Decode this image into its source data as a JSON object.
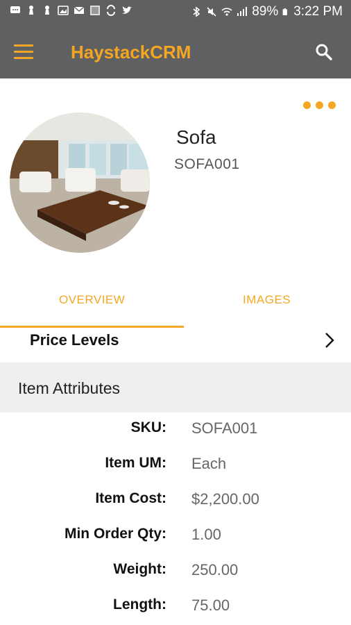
{
  "status_bar": {
    "battery": "89%",
    "time": "3:22 PM"
  },
  "app_bar": {
    "title": "HaystackCRM",
    "menu_icon": "hamburger-menu-icon",
    "search_icon": "search-icon",
    "accent_color": "#f5a623",
    "background_color": "#5f6061"
  },
  "item": {
    "name": "Sofa",
    "code": "SOFA001",
    "more_icon": "more-dots-icon"
  },
  "tabs": [
    {
      "label": "OVERVIEW",
      "active": true
    },
    {
      "label": "IMAGES",
      "active": false
    }
  ],
  "price_levels": {
    "label": "Price Levels",
    "icon": "chevron-right-icon"
  },
  "attributes": {
    "header": "Item Attributes",
    "rows": [
      {
        "label": "SKU:",
        "value": "SOFA001"
      },
      {
        "label": "Item UM:",
        "value": "Each"
      },
      {
        "label": "Item Cost:",
        "value": "$2,200.00"
      },
      {
        "label": "Min Order Qty:",
        "value": "1.00"
      },
      {
        "label": "Weight:",
        "value": "250.00"
      },
      {
        "label": "Length:",
        "value": "75.00"
      }
    ]
  }
}
